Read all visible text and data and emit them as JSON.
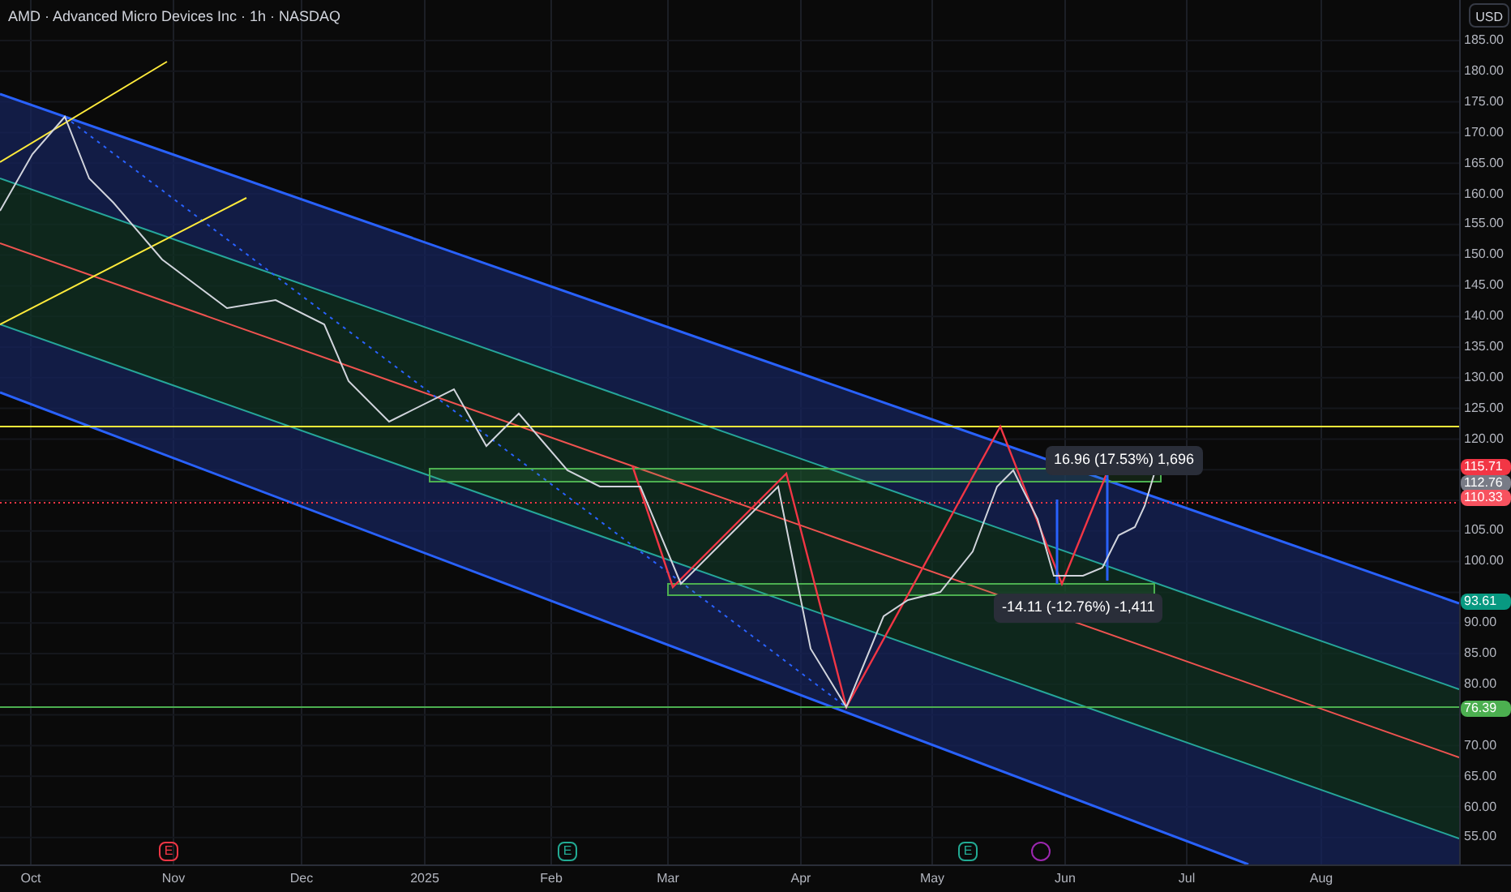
{
  "header": {
    "title": "AMD · Advanced Micro Devices Inc · 1h · NASDAQ"
  },
  "price_axis": {
    "currency": "USD",
    "labels": [
      "185.00",
      "180.00",
      "175.00",
      "170.00",
      "165.00",
      "160.00",
      "155.00",
      "150.00",
      "145.00",
      "140.00",
      "135.00",
      "130.00",
      "125.00",
      "120.00",
      "105.00",
      "100.00",
      "90.00",
      "85.00",
      "80.00",
      "70.00",
      "65.00",
      "60.00",
      "55.00"
    ],
    "tags": [
      {
        "text": "115.71",
        "color": "#f23645"
      },
      {
        "text": "112.76",
        "color": "#787b86"
      },
      {
        "text": "110.33",
        "color": "#f7525f"
      },
      {
        "text": "93.61",
        "color": "#089981"
      },
      {
        "text": "76.39",
        "color": "#4caf50"
      }
    ]
  },
  "measures": [
    {
      "text": "16.96 (17.53%) 1,696"
    },
    {
      "text": "-14.11 (-12.76%) -1,411"
    }
  ],
  "events": [
    {
      "kind": "earnings",
      "label": "E",
      "color": "#f23645"
    },
    {
      "kind": "earnings",
      "label": "E",
      "color": "#22ab94"
    },
    {
      "kind": "earnings",
      "label": "E",
      "color": "#22ab94"
    },
    {
      "kind": "other",
      "color": "#9c27b0"
    }
  ],
  "time_axis": {
    "labels": [
      "Oct",
      "Nov",
      "Dec",
      "2025",
      "Feb",
      "Mar",
      "Apr",
      "May",
      "Jun",
      "Jul",
      "Aug"
    ]
  }
}
